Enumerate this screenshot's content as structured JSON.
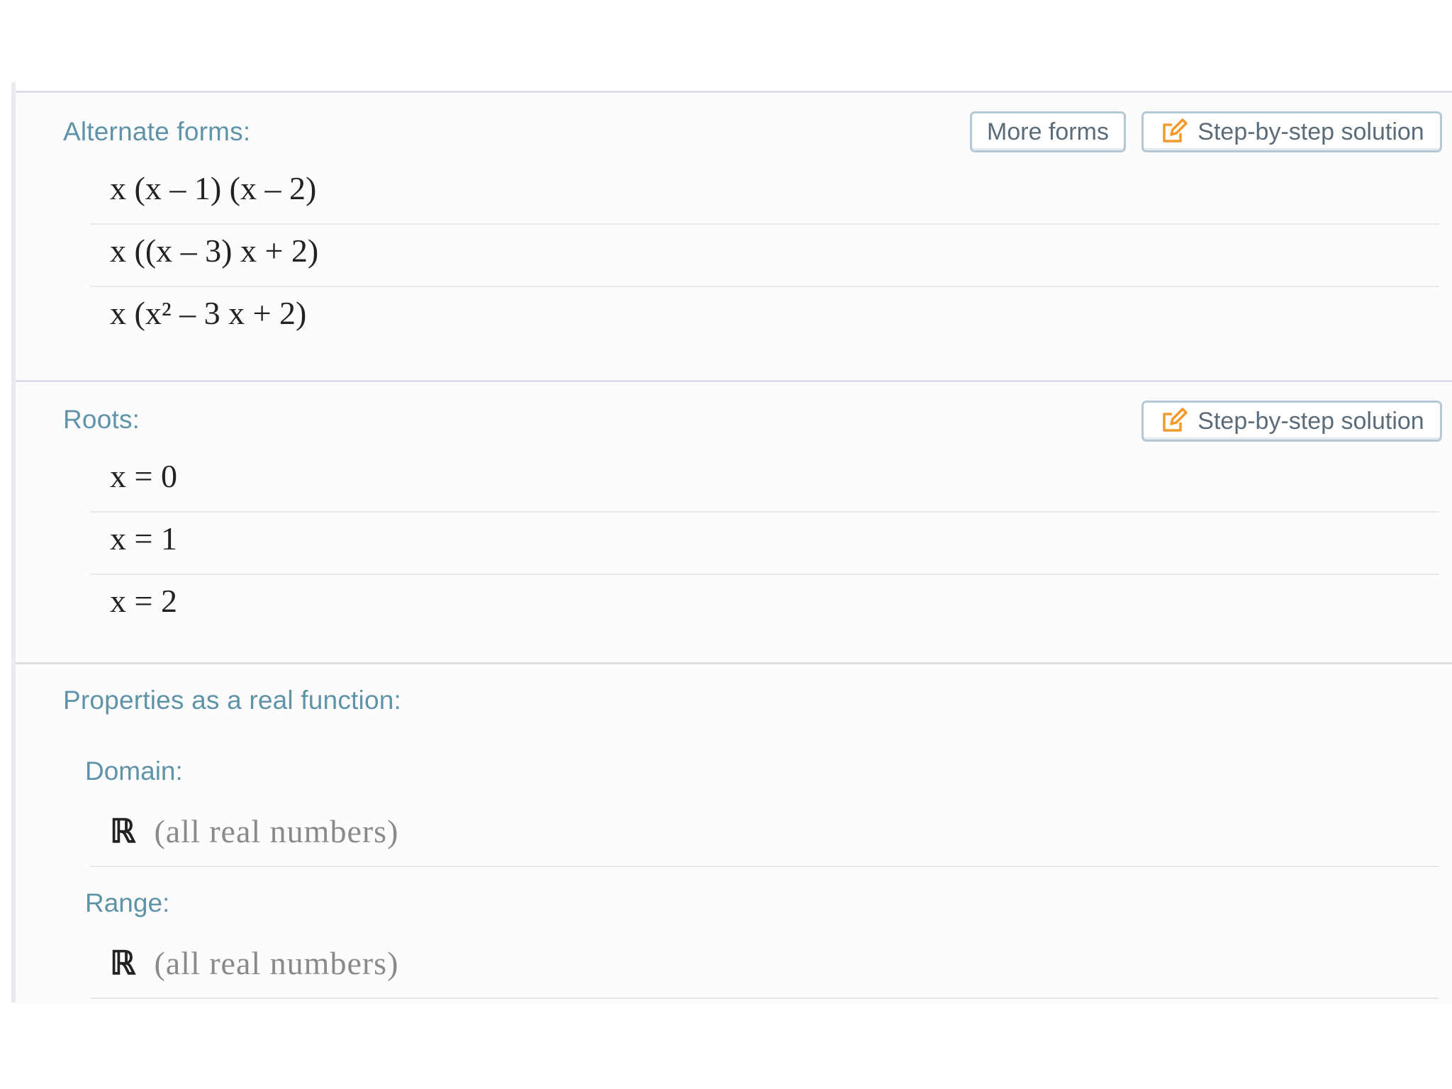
{
  "alternate_forms": {
    "title": "Alternate forms:",
    "more_forms_label": "More forms",
    "step_label": "Step-by-step solution",
    "forms": [
      "x (x – 1) (x – 2)",
      "x ((x – 3) x + 2)",
      "x (x² – 3 x + 2)"
    ]
  },
  "roots": {
    "title": "Roots:",
    "step_label": "Step-by-step solution",
    "items": [
      "x = 0",
      "x = 1",
      "x = 2"
    ]
  },
  "properties": {
    "title": "Properties as a real function:",
    "domain": {
      "label": "Domain:",
      "symbol": "ℝ",
      "description": "(all real numbers)"
    },
    "range": {
      "label": "Range:",
      "symbol": "ℝ",
      "description": "(all real numbers)"
    }
  },
  "colors": {
    "title": "#5f93a8",
    "icon": "#f39a2b",
    "button_border": "#b6c8d3"
  },
  "icons": {
    "step_icon": "edit-pencil-icon"
  }
}
